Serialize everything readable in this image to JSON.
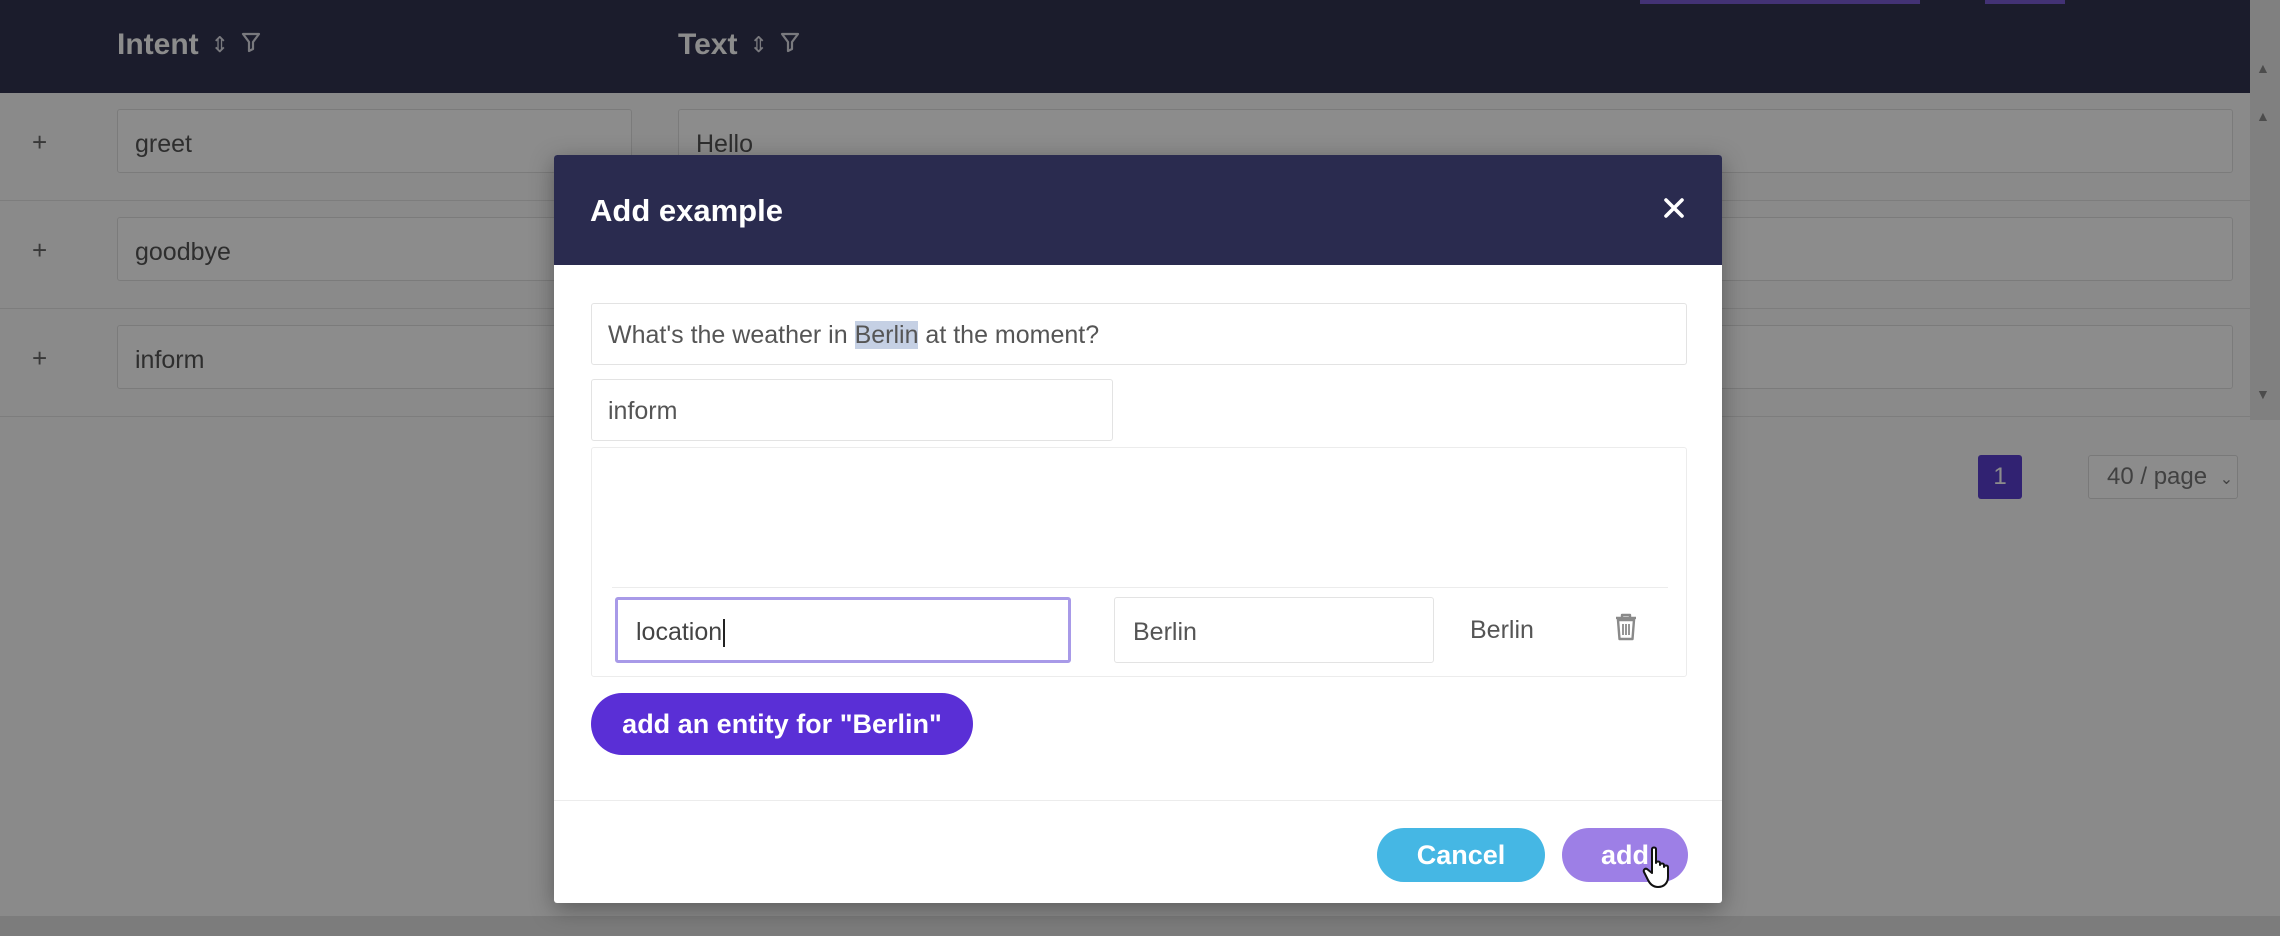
{
  "table": {
    "columns": [
      {
        "label": "Intent",
        "sort_icon": "sort-icon",
        "filter_icon": "filter-icon"
      },
      {
        "label": "Text",
        "sort_icon": "sort-icon",
        "filter_icon": "filter-icon"
      }
    ],
    "rows": [
      {
        "intent": "greet",
        "text": "Hello"
      },
      {
        "intent": "goodbye",
        "text": ""
      },
      {
        "intent": "inform",
        "text": ""
      }
    ],
    "expand_symbol": "+"
  },
  "pagination": {
    "current_page": "1",
    "page_size": "40 / page"
  },
  "modal": {
    "title": "Add example",
    "close_symbol": "✕",
    "sentence": {
      "before": "What's the weather in ",
      "highlight": "Berlin",
      "after": " at the moment?"
    },
    "intent_value": "inform",
    "entity": {
      "name": "location",
      "value": "Berlin",
      "match": "Berlin"
    },
    "add_entity_label": "add an entity for \"Berlin\"",
    "cancel_label": "Cancel",
    "add_label": "add"
  },
  "colors": {
    "header_bg": "#323451",
    "modal_header_bg": "#2a2b4f",
    "primary_purple": "#5a2fd6",
    "cancel_blue": "#45b7e4",
    "add_light_purple": "#9d7fe6",
    "focus_border": "#a89ae8",
    "highlight": "#c5d0e4"
  }
}
